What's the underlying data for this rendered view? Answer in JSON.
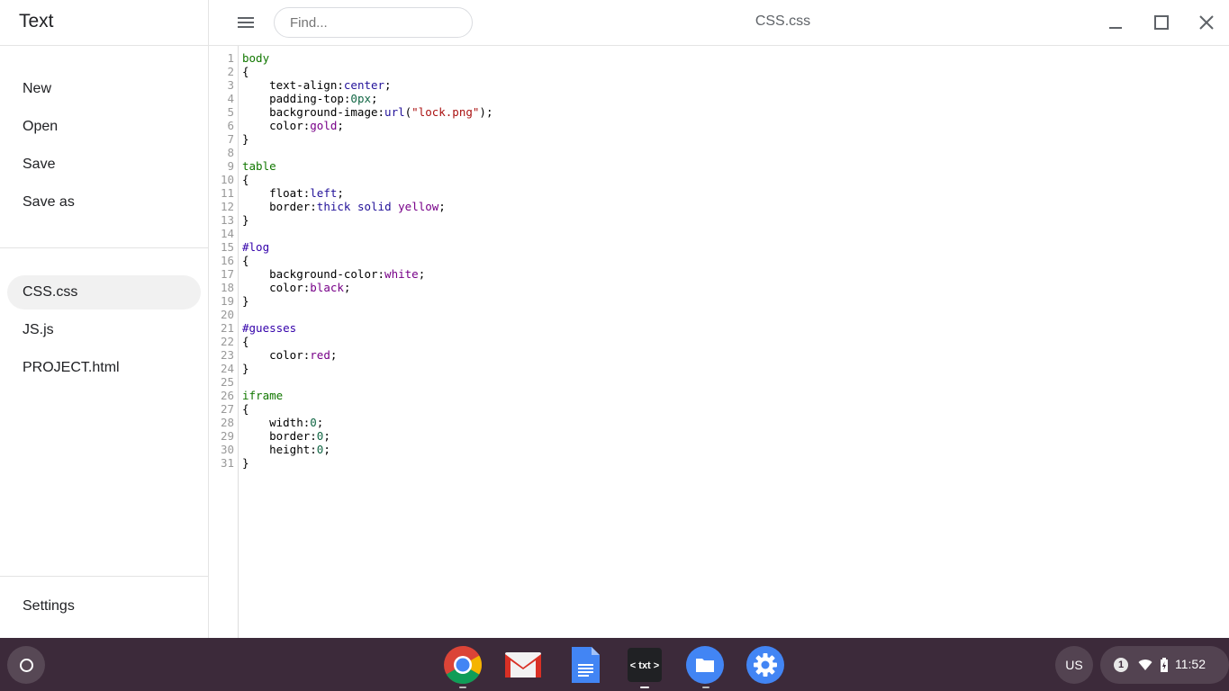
{
  "sidebar": {
    "app_title": "Text",
    "actions": [
      "New",
      "Open",
      "Save",
      "Save as"
    ],
    "files": [
      "CSS.css",
      "JS.js",
      "PROJECT.html"
    ],
    "active_file_index": 0,
    "settings_label": "Settings"
  },
  "header": {
    "search_placeholder": "Find...",
    "document_title": "CSS.css"
  },
  "editor": {
    "lines": [
      [
        {
          "t": "body",
          "c": "sel"
        }
      ],
      [
        {
          "t": "{",
          "c": "punct"
        }
      ],
      [
        {
          "t": "    text-align",
          "c": "prop"
        },
        {
          "t": ":",
          "c": "punct"
        },
        {
          "t": "center",
          "c": "atom"
        },
        {
          "t": ";",
          "c": "punct"
        }
      ],
      [
        {
          "t": "    padding-top",
          "c": "prop"
        },
        {
          "t": ":",
          "c": "punct"
        },
        {
          "t": "0px",
          "c": "num"
        },
        {
          "t": ";",
          "c": "punct"
        }
      ],
      [
        {
          "t": "    background-image",
          "c": "prop"
        },
        {
          "t": ":",
          "c": "punct"
        },
        {
          "t": "url",
          "c": "atom"
        },
        {
          "t": "(",
          "c": "punct"
        },
        {
          "t": "\"lock.png\"",
          "c": "str"
        },
        {
          "t": ");",
          "c": "punct"
        }
      ],
      [
        {
          "t": "    color",
          "c": "prop"
        },
        {
          "t": ":",
          "c": "punct"
        },
        {
          "t": "gold",
          "c": "kw"
        },
        {
          "t": ";",
          "c": "punct"
        }
      ],
      [
        {
          "t": "}",
          "c": "punct"
        }
      ],
      [],
      [
        {
          "t": "table",
          "c": "sel"
        }
      ],
      [
        {
          "t": "{",
          "c": "punct"
        }
      ],
      [
        {
          "t": "    float",
          "c": "prop"
        },
        {
          "t": ":",
          "c": "punct"
        },
        {
          "t": "left",
          "c": "atom"
        },
        {
          "t": ";",
          "c": "punct"
        }
      ],
      [
        {
          "t": "    border",
          "c": "prop"
        },
        {
          "t": ":",
          "c": "punct"
        },
        {
          "t": "thick",
          "c": "atom"
        },
        {
          "t": " ",
          "c": "punct"
        },
        {
          "t": "solid",
          "c": "atom"
        },
        {
          "t": " ",
          "c": "punct"
        },
        {
          "t": "yellow",
          "c": "kw"
        },
        {
          "t": ";",
          "c": "punct"
        }
      ],
      [
        {
          "t": "}",
          "c": "punct"
        }
      ],
      [],
      [
        {
          "t": "#log",
          "c": "id"
        }
      ],
      [
        {
          "t": "{",
          "c": "punct"
        }
      ],
      [
        {
          "t": "    background-color",
          "c": "prop"
        },
        {
          "t": ":",
          "c": "punct"
        },
        {
          "t": "white",
          "c": "kw"
        },
        {
          "t": ";",
          "c": "punct"
        }
      ],
      [
        {
          "t": "    color",
          "c": "prop"
        },
        {
          "t": ":",
          "c": "punct"
        },
        {
          "t": "black",
          "c": "kw"
        },
        {
          "t": ";",
          "c": "punct"
        }
      ],
      [
        {
          "t": "}",
          "c": "punct"
        }
      ],
      [],
      [
        {
          "t": "#guesses",
          "c": "id"
        }
      ],
      [
        {
          "t": "{",
          "c": "punct"
        }
      ],
      [
        {
          "t": "    color",
          "c": "prop"
        },
        {
          "t": ":",
          "c": "punct"
        },
        {
          "t": "red",
          "c": "kw"
        },
        {
          "t": ";",
          "c": "punct"
        }
      ],
      [
        {
          "t": "}",
          "c": "punct"
        }
      ],
      [],
      [
        {
          "t": "iframe",
          "c": "sel"
        }
      ],
      [
        {
          "t": "{",
          "c": "punct"
        }
      ],
      [
        {
          "t": "    width",
          "c": "prop"
        },
        {
          "t": ":",
          "c": "punct"
        },
        {
          "t": "0",
          "c": "num"
        },
        {
          "t": ";",
          "c": "punct"
        }
      ],
      [
        {
          "t": "    border",
          "c": "prop"
        },
        {
          "t": ":",
          "c": "punct"
        },
        {
          "t": "0",
          "c": "num"
        },
        {
          "t": ";",
          "c": "punct"
        }
      ],
      [
        {
          "t": "    height",
          "c": "prop"
        },
        {
          "t": ":",
          "c": "punct"
        },
        {
          "t": "0",
          "c": "num"
        },
        {
          "t": ";",
          "c": "punct"
        }
      ],
      [
        {
          "t": "}",
          "c": "punct"
        }
      ]
    ]
  },
  "shelf": {
    "apps": [
      "chrome-icon",
      "gmail-icon",
      "docs-icon",
      "text-app-icon",
      "files-icon",
      "settings-icon"
    ],
    "text_app_glyph": "< txt >",
    "ime_label": "US",
    "notification_count": "1",
    "time": "11:52"
  },
  "colors": {
    "shelf_bg": "#3c2a3a",
    "selector": "#117700",
    "id_selector": "#3300aa",
    "atom": "#221199",
    "keyword": "#770088",
    "number": "#116644",
    "string": "#aa1111"
  }
}
